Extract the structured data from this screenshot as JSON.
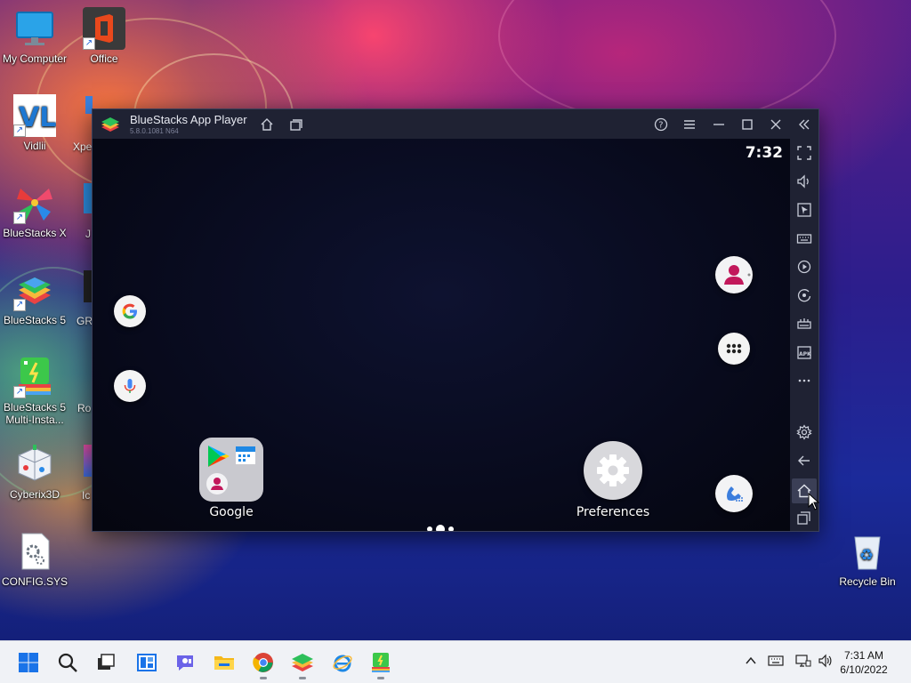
{
  "desktop": {
    "icons": {
      "my_computer": "My Computer",
      "office": "Office",
      "vidlii": "Vidlii",
      "xpe_partial": "Xpe",
      "bluestacks_x": "BlueStacks X",
      "j_partial": "J",
      "bluestacks5": "BlueStacks 5",
      "gr_partial": "GR",
      "bluestacks5_multi_line1": "BlueStacks 5",
      "bluestacks5_multi_line2": "Multi-Insta...",
      "ro_partial": "Ro",
      "cyberix": "Cyberix3D",
      "ic_partial": "Ic",
      "config": "CONFIG.SYS",
      "recycle_bin": "Recycle Bin"
    }
  },
  "bluestacks": {
    "title": "BlueStacks App Player",
    "version": "5.8.0.1081 N64",
    "titlebar_icons": [
      "home-icon",
      "multi-instance-icon",
      "help-icon",
      "menu-icon",
      "minimize-icon",
      "maximize-icon",
      "close-icon",
      "collapse-sidebar-icon"
    ],
    "android": {
      "time": "7:32",
      "folder_label": "Google",
      "preferences_label": "Preferences"
    },
    "sidebar_icons": [
      "fullscreen-icon",
      "volume-icon",
      "pointer-icon",
      "keyboard-icon",
      "macro-icon",
      "rotate-icon",
      "gamepad-icon",
      "apk-icon",
      "more-icon",
      "settings-icon",
      "back-icon",
      "home-icon",
      "recent-apps-icon"
    ]
  },
  "taskbar": {
    "time": "7:31 AM",
    "date": "6/10/2022",
    "apps": [
      "start-icon",
      "search-icon",
      "task-view-icon",
      "widgets-icon",
      "chat-icon",
      "file-explorer-icon",
      "chrome-icon",
      "bluestacks-icon",
      "internet-explorer-icon",
      "bluestacks-multi-icon"
    ],
    "tray": [
      "chevron-up-icon",
      "keyboard-icon",
      "network-icon",
      "volume-icon"
    ]
  },
  "colors": {
    "window_bg": "#1f2233",
    "android_bg": "#070919",
    "taskbar_bg": "#f0f2f6"
  }
}
